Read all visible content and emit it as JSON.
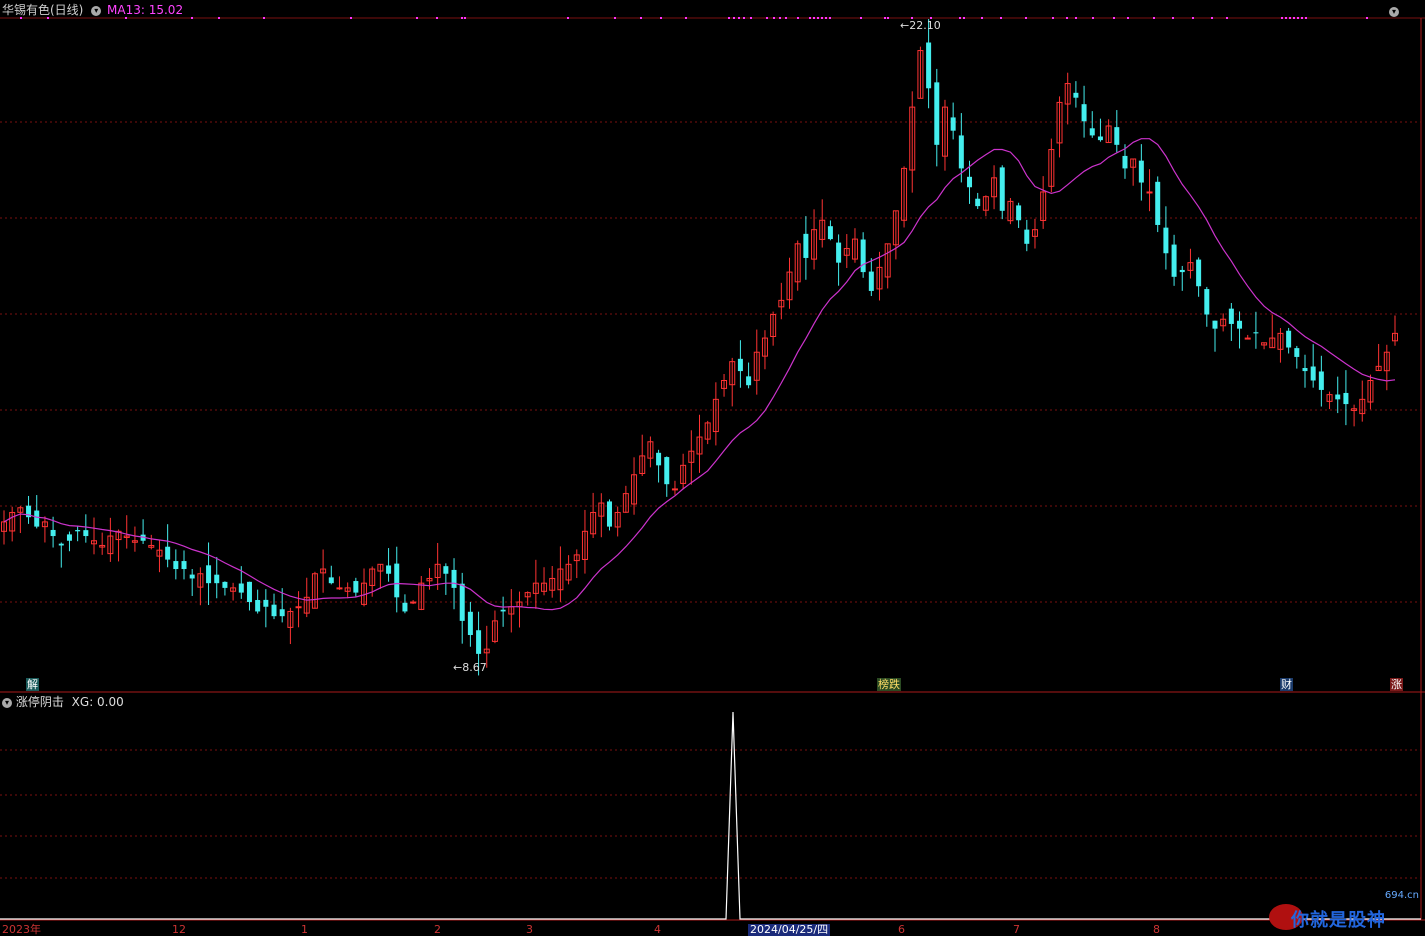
{
  "header": {
    "title": "华锡有色(日线)",
    "ma_label": "MA13: 15.02",
    "title_color": "#d0d0d0",
    "ma_color": "#ff44ff"
  },
  "sub_header": {
    "title": "涨停阴击",
    "value": "XG: 0.00"
  },
  "annotations": {
    "high": "22.10",
    "low": "8.67"
  },
  "event_tags": [
    {
      "name": "tag-jie",
      "text": "解",
      "color": "#ffffff",
      "bg": "#1a5a5a"
    },
    {
      "name": "tag-bangdie",
      "text": "榜跌",
      "color": "#ffdd66",
      "bg": "#2a4a22"
    },
    {
      "name": "tag-cai",
      "text": "财",
      "color": "#ffffff",
      "bg": "#1a3a6a"
    },
    {
      "name": "tag-zhang",
      "text": "涨",
      "color": "#ffffff",
      "bg": "#7a1a1a"
    }
  ],
  "x_axis": {
    "labels": [
      "2023年",
      "12",
      "1",
      "2",
      "3",
      "4",
      "2024/04/25/四",
      "6",
      "7",
      "8"
    ]
  },
  "watermark": {
    "site": "694.cn",
    "text": "你就是股神"
  },
  "colors": {
    "up": "#ff3333",
    "down": "#44eeee",
    "ma": "#cc33cc",
    "grid": "#7a1010",
    "signal": "#ffffff",
    "dots": "#ff33ff"
  },
  "chart_data": {
    "type": "candlestick",
    "title": "华锡有色(日线)",
    "ma_period": 13,
    "ma_last": 15.02,
    "price_high": 22.1,
    "price_low": 8.67,
    "closes_approx": [
      11.6,
      11.8,
      11.9,
      11.7,
      11.5,
      11.6,
      11.3,
      11.1,
      11.2,
      11.4,
      11.3,
      11.2,
      11.1,
      11.3,
      11.4,
      11.3,
      11.2,
      11.2,
      11.1,
      11.0,
      10.8,
      10.6,
      10.6,
      10.4,
      10.5,
      10.3,
      10.3,
      10.2,
      10.2,
      10.1,
      9.9,
      9.7,
      9.8,
      9.6,
      9.6,
      9.7,
      9.8,
      10.0,
      10.5,
      10.6,
      10.3,
      10.2,
      10.2,
      10.1,
      10.3,
      10.6,
      10.7,
      10.5,
      10.0,
      9.7,
      9.9,
      10.3,
      10.4,
      10.7,
      10.5,
      10.2,
      9.5,
      9.2,
      8.8,
      8.9,
      9.5,
      9.7,
      9.8,
      9.9,
      10.1,
      10.3,
      10.3,
      10.4,
      10.6,
      10.7,
      10.9,
      11.4,
      11.8,
      12.0,
      11.5,
      11.8,
      12.2,
      12.6,
      13.0,
      13.3,
      12.8,
      12.4,
      12.3,
      12.8,
      13.1,
      13.4,
      13.7,
      14.2,
      14.6,
      15.0,
      14.8,
      14.5,
      15.2,
      15.5,
      16.0,
      16.3,
      16.9,
      17.5,
      17.2,
      17.8,
      18.0,
      17.6,
      17.1,
      17.4,
      17.6,
      16.9,
      16.5,
      17.0,
      17.5,
      18.2,
      19.1,
      20.4,
      21.6,
      20.8,
      19.6,
      20.4,
      19.9,
      19.1,
      18.7,
      18.3,
      18.5,
      18.9,
      18.2,
      18.4,
      18.0,
      17.5,
      17.8,
      18.6,
      19.5,
      20.5,
      20.9,
      20.6,
      20.1,
      19.8,
      19.7,
      20.0,
      19.6,
      19.1,
      19.3,
      18.8,
      18.6,
      17.9,
      17.3,
      16.8,
      16.9,
      17.1,
      16.6,
      16.0,
      15.7,
      15.9,
      15.8,
      15.7,
      15.5,
      15.6,
      15.4,
      15.5,
      15.6,
      15.3,
      15.1,
      14.8,
      14.6,
      14.4,
      14.3,
      14.2,
      14.1,
      14.0,
      14.2,
      14.6,
      14.9,
      15.2,
      15.6
    ],
    "signal": {
      "date": "2024/04/25",
      "value": 1
    },
    "sub_indicator": "涨停阴击",
    "xg_value": 0.0
  }
}
